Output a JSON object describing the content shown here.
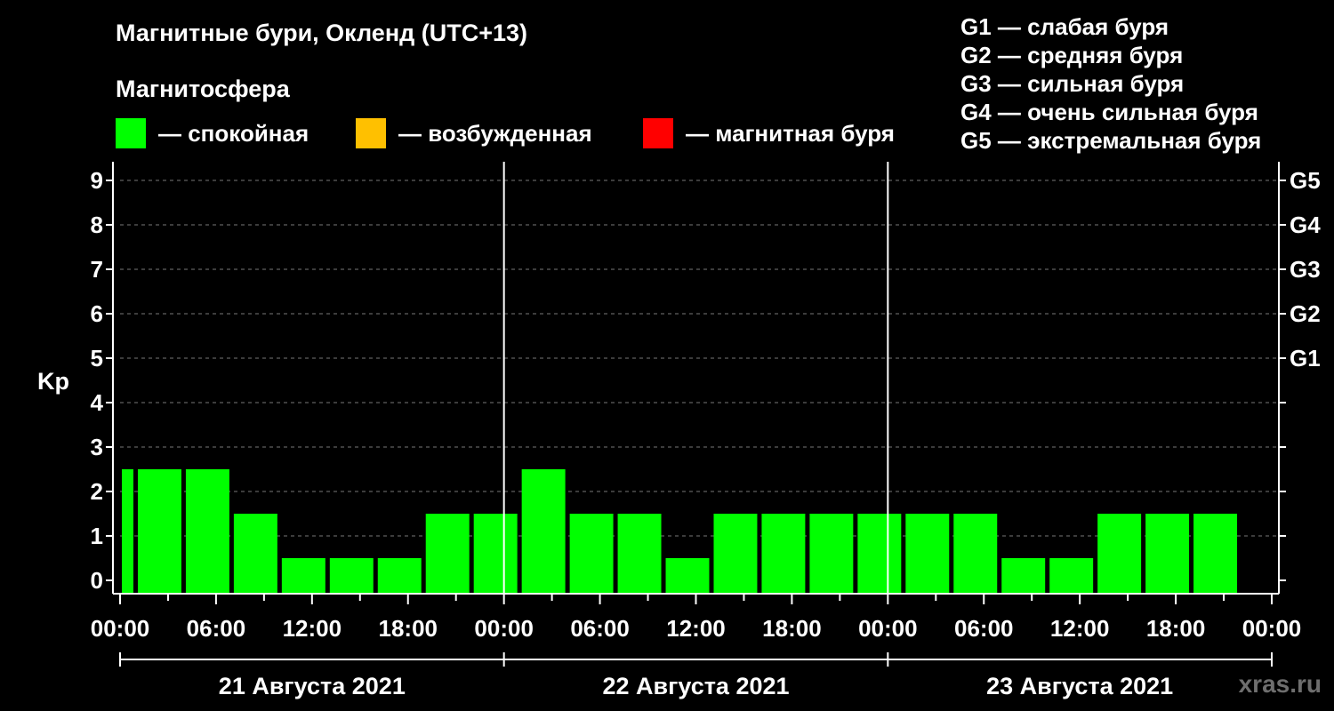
{
  "title": "Магнитные бури, Окленд (UTC+13)",
  "subtitle": "Магнитосфера",
  "legend": [
    {
      "color": "#00ff00",
      "label": "— спокойная"
    },
    {
      "color": "#ffc000",
      "label": "— возбужденная"
    },
    {
      "color": "#ff0000",
      "label": "— магнитная буря"
    }
  ],
  "storm_legend": [
    "G1 — слабая буря",
    "G2 — средняя буря",
    "G3 — сильная буря",
    "G4 — очень сильная буря",
    "G5 — экстремальная буря"
  ],
  "site": "xras.ru",
  "chart_data": {
    "type": "bar",
    "ylabel": "Kp",
    "ylim": [
      0,
      9
    ],
    "yticks": [
      0,
      1,
      2,
      3,
      4,
      5,
      6,
      7,
      8,
      9
    ],
    "right_ticks": [
      {
        "kp": 5,
        "label": "G1"
      },
      {
        "kp": 6,
        "label": "G2"
      },
      {
        "kp": 7,
        "label": "G3"
      },
      {
        "kp": 8,
        "label": "G4"
      },
      {
        "kp": 9,
        "label": "G5"
      }
    ],
    "grid": true,
    "x_unit_hours": 72,
    "xtick_labels": [
      "00:00",
      "06:00",
      "12:00",
      "18:00",
      "00:00",
      "06:00",
      "12:00",
      "18:00",
      "00:00",
      "06:00",
      "12:00",
      "18:00",
      "00:00"
    ],
    "days": [
      "21 Августа 2021",
      "22 Августа 2021",
      "23 Августа 2021"
    ],
    "bars": [
      {
        "start": 0,
        "end": 1,
        "kp": 2,
        "color": "#00ff00"
      },
      {
        "start": 1,
        "end": 4,
        "kp": 2,
        "color": "#00ff00"
      },
      {
        "start": 4,
        "end": 7,
        "kp": 2,
        "color": "#00ff00"
      },
      {
        "start": 7,
        "end": 10,
        "kp": 1,
        "color": "#00ff00"
      },
      {
        "start": 10,
        "end": 13,
        "kp": 0,
        "color": "#00ff00"
      },
      {
        "start": 13,
        "end": 16,
        "kp": 0,
        "color": "#00ff00"
      },
      {
        "start": 16,
        "end": 19,
        "kp": 0,
        "color": "#00ff00"
      },
      {
        "start": 19,
        "end": 22,
        "kp": 1,
        "color": "#00ff00"
      },
      {
        "start": 22,
        "end": 25,
        "kp": 1,
        "color": "#00ff00"
      },
      {
        "start": 25,
        "end": 28,
        "kp": 2,
        "color": "#00ff00"
      },
      {
        "start": 28,
        "end": 31,
        "kp": 1,
        "color": "#00ff00"
      },
      {
        "start": 31,
        "end": 34,
        "kp": 1,
        "color": "#00ff00"
      },
      {
        "start": 34,
        "end": 37,
        "kp": 0,
        "color": "#00ff00"
      },
      {
        "start": 37,
        "end": 40,
        "kp": 1,
        "color": "#00ff00"
      },
      {
        "start": 40,
        "end": 43,
        "kp": 1,
        "color": "#00ff00"
      },
      {
        "start": 43,
        "end": 46,
        "kp": 1,
        "color": "#00ff00"
      },
      {
        "start": 46,
        "end": 49,
        "kp": 1,
        "color": "#00ff00"
      },
      {
        "start": 49,
        "end": 52,
        "kp": 1,
        "color": "#00ff00"
      },
      {
        "start": 52,
        "end": 55,
        "kp": 1,
        "color": "#00ff00"
      },
      {
        "start": 55,
        "end": 58,
        "kp": 0,
        "color": "#00ff00"
      },
      {
        "start": 58,
        "end": 61,
        "kp": 0,
        "color": "#00ff00"
      },
      {
        "start": 61,
        "end": 64,
        "kp": 1,
        "color": "#00ff00"
      },
      {
        "start": 64,
        "end": 67,
        "kp": 1,
        "color": "#00ff00"
      },
      {
        "start": 67,
        "end": 70,
        "kp": 1,
        "color": "#00ff00"
      }
    ]
  }
}
